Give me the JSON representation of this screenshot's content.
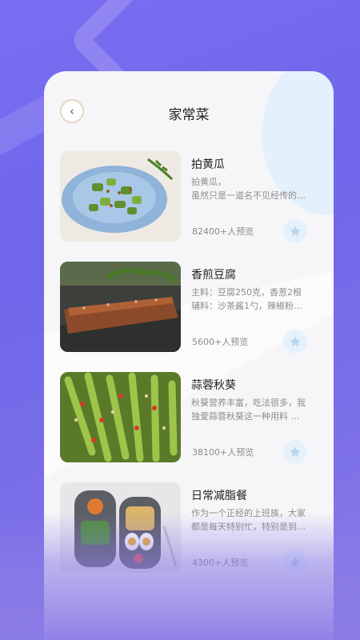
{
  "header": {
    "title": "家常菜"
  },
  "icons": {
    "back": "chevron-left-icon",
    "favorite": "star-icon"
  },
  "colors": {
    "accent": "#7b6df2",
    "card": "#f6f6f8",
    "favorite_bg": "#e6f2fb",
    "favorite_star": "#b9d6ec"
  },
  "recipes": [
    {
      "name": "拍黄瓜",
      "desc_lines": [
        "拍黄瓜，",
        "虽然只是一道名不见经传的…"
      ],
      "views": "82400+人预览"
    },
    {
      "name": "香煎豆腐",
      "desc_lines": [
        "主料：豆腐250克，香葱2根",
        "辅料：沙茶酱1勺，辣椒粉…"
      ],
      "views": "5600+人预览"
    },
    {
      "name": "蒜蓉秋葵",
      "desc_lines": [
        "秋葵营养丰富，吃法很多，我",
        "独爱蒜蓉秋葵这一种用料 …"
      ],
      "views": "38100+人预览"
    },
    {
      "name": "日常减脂餐",
      "desc_lines": [
        "作为一个正经的上班族，大家",
        "都是每天特别忙，特别是到…"
      ],
      "views": "4300+人预览"
    }
  ]
}
